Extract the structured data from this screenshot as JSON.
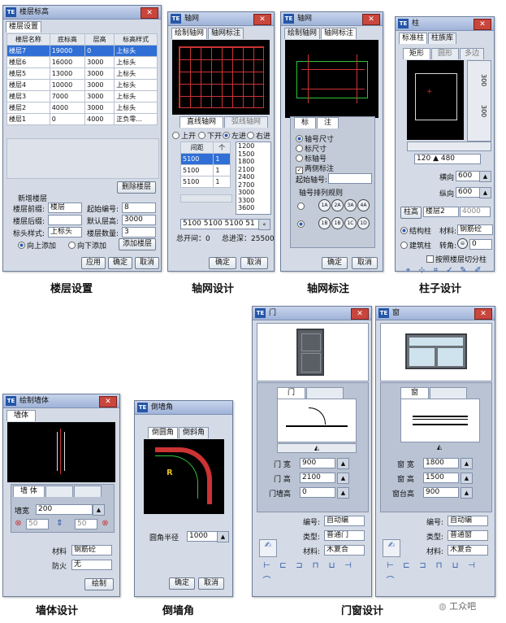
{
  "captions": {
    "floor": "楼层设置",
    "grid": "轴网设计",
    "grid_mark": "轴网标注",
    "column": "柱子设计",
    "wall": "墙体设计",
    "chamfer": "倒墙角",
    "door_window": "门窗设计"
  },
  "watermark": "工众吧",
  "floor_win": {
    "title": "楼层标高",
    "tab": "楼层设置",
    "headers": [
      "楼层名称",
      "底标高",
      "层高",
      "标高样式"
    ],
    "rows": [
      [
        "楼层7",
        "19000",
        "0",
        "上标头"
      ],
      [
        "楼层6",
        "16000",
        "3000",
        "上标头"
      ],
      [
        "楼层5",
        "13000",
        "3000",
        "上标头"
      ],
      [
        "楼层4",
        "10000",
        "3000",
        "上标头"
      ],
      [
        "楼层3",
        "7000",
        "3000",
        "上标头"
      ],
      [
        "楼层2",
        "4000",
        "3000",
        "上标头"
      ],
      [
        "楼层1",
        "0",
        "4000",
        "正负零..."
      ]
    ],
    "delete_btn": "删除楼层",
    "new_group": "新增楼层",
    "prefix_label": "楼层前缀:",
    "prefix_val": "楼层",
    "start_label": "起始编号:",
    "start_val": "8",
    "suffix_label": "楼层后缀:",
    "default_h_label": "默认层高:",
    "default_h_val": "3000",
    "style_label": "标头样式:",
    "style_val": "上标头",
    "count_label": "楼层数量:",
    "count_val": "3",
    "up_add": "向上添加",
    "down_add": "向下添加",
    "add_btn": "添加楼层",
    "apply": "应用",
    "ok": "确定",
    "cancel": "取消"
  },
  "grid_win": {
    "title": "轴网",
    "tabs": [
      "绘制轴网",
      "轴网标注"
    ],
    "subtabs": [
      "直线轴网",
      "弧线轴网"
    ],
    "radios": [
      "上开",
      "下开",
      "左进",
      "右进"
    ],
    "col_headers": [
      "间距",
      "个"
    ],
    "rows": [
      [
        "5100",
        "1"
      ],
      [
        "5100",
        "1"
      ],
      [
        "5100",
        "1"
      ]
    ],
    "values": [
      "1200",
      "1500",
      "1800",
      "2100",
      "2400",
      "2700",
      "3000",
      "3300",
      "3600"
    ],
    "seq": "5100 5100 5100 51",
    "total_open": "总开间：0",
    "total_depth": "总进深：25500",
    "ok": "确定",
    "cancel": "取消"
  },
  "mark_win": {
    "title": "轴网",
    "tabs": [
      "绘制轴网",
      "轴网标注"
    ],
    "inner_tabs": [
      "标",
      "注"
    ],
    "options": [
      "轴号尺寸",
      "标尺寸",
      "标轴号",
      "两侧标注"
    ],
    "start_label": "起始轴号:",
    "rule_label": "轴号排列规则",
    "row1": [
      "1A",
      "2A",
      "3A",
      "4A"
    ],
    "row2": [
      "1B",
      "1B",
      "1C",
      "1D"
    ],
    "ok": "确定",
    "cancel": "取消"
  },
  "col_win": {
    "title": "柱",
    "tabs": [
      "标准柱",
      "柱族库"
    ],
    "shape_tabs": [
      "矩形",
      "圆形",
      "多边"
    ],
    "dim_v1": "300",
    "dim_v2": "300",
    "bottom_vals": [
      "120",
      "480"
    ],
    "h_label": "横向",
    "h_val": "600",
    "v_label": "纵向",
    "v_val": "600",
    "height_label": "柱高",
    "height_val": "楼层2",
    "height_num": "4000",
    "r1": "结构柱",
    "mat_label": "材料:",
    "mat_val": "钢筋砼",
    "r2": "建筑柱",
    "angle_label": "转角:",
    "angle_val": "0",
    "cut_label": "按照楼层切分柱"
  },
  "wall_win": {
    "title": "绘制墙体",
    "tab": "墙体",
    "inner_tab": "墙 体",
    "width_label": "墙宽",
    "width_val": "200",
    "left_val": "50",
    "right_val": "50",
    "mat_label": "材料",
    "mat_val": "钢筋砼",
    "fire_label": "防火",
    "fire_val": "无",
    "draw_btn": "绘制"
  },
  "chamfer_win": {
    "title": "倒墙角",
    "tabs": [
      "倒圆角",
      "倒斜角"
    ],
    "r_label": "R",
    "radius_label": "圆角半径",
    "radius_val": "1000",
    "ok": "确定",
    "cancel": "取消"
  },
  "door_win": {
    "title": "门",
    "tab": "门",
    "w_label": "门 宽",
    "w_val": "900",
    "h_label": "门 高",
    "h_val": "2100",
    "sill_label": "门墙高",
    "sill_val": "0",
    "num_label": "编号:",
    "num_val": "自动编",
    "type_label": "类型:",
    "type_val": "普通门",
    "mat_label": "材料:",
    "mat_val": "木复合"
  },
  "window_win": {
    "title": "窗",
    "tab": "窗",
    "w_label": "窗 宽",
    "w_val": "1800",
    "h_label": "窗 高",
    "h_val": "1500",
    "sill_label": "窗台高",
    "sill_val": "900",
    "num_label": "编号:",
    "num_val": "自动编",
    "type_label": "类型:",
    "type_val": "普通窗",
    "mat_label": "材料:",
    "mat_val": "木复合"
  }
}
